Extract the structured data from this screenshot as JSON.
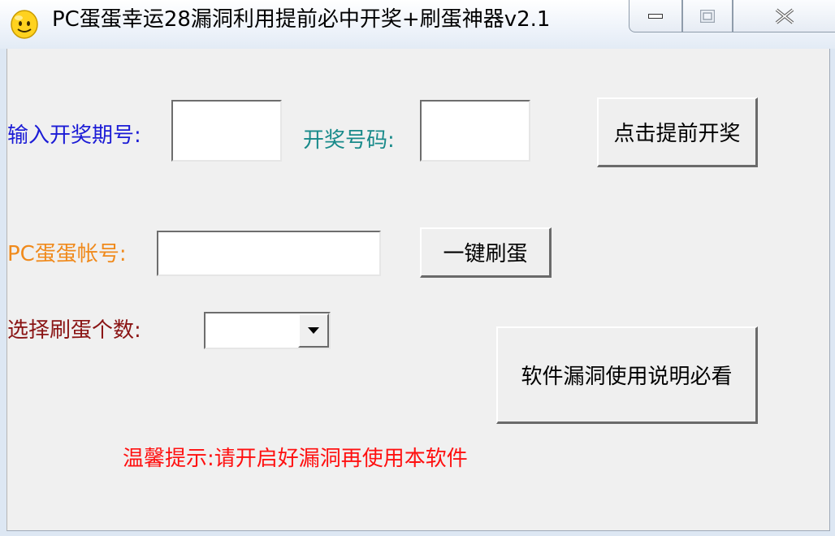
{
  "window": {
    "title": "PC蛋蛋幸运28漏洞利用提前必中开奖+刷蛋神器v2.1",
    "icon": "smiley-face-icon",
    "controls": [
      "minimize-icon",
      "maximize-icon",
      "close-icon"
    ]
  },
  "form": {
    "period_label": "输入开奖期号:",
    "period_value": "",
    "number_label": "开奖号码:",
    "number_value": "",
    "draw_button": "点击提前开奖",
    "account_label": "PC蛋蛋帐号:",
    "account_value": "",
    "refill_button": "一键刷蛋",
    "count_label": "选择刷蛋个数:",
    "count_selected": "",
    "manual_button": "软件漏洞使用说明必看",
    "tip": "温馨提示:请开启好漏洞再使用本软件"
  },
  "colors": {
    "period_label": "#1b1bd6",
    "number_label": "#188a8a",
    "account_label": "#f08a1c",
    "count_label": "#8a1414",
    "tip": "#ff1010"
  }
}
